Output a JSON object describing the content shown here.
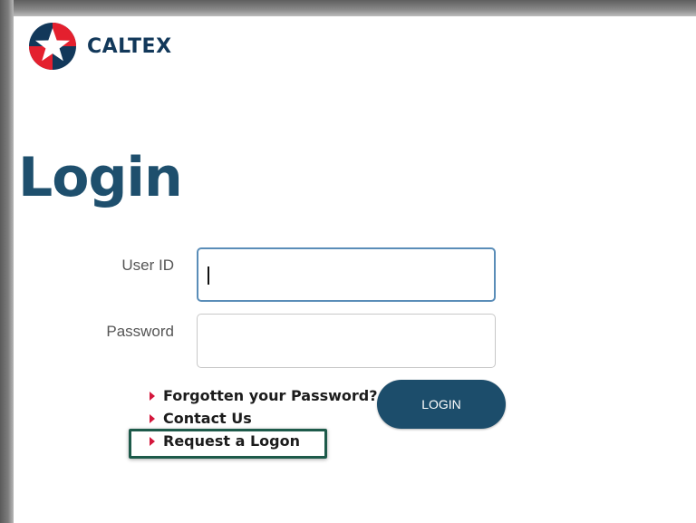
{
  "brand": {
    "name": "CALTEX",
    "colors": {
      "primary": "#1e4f6d",
      "accent_red": "#d4163c",
      "logo_red": "#e4202e",
      "logo_blue": "#12385a"
    }
  },
  "page": {
    "title": "Login"
  },
  "form": {
    "user_id_label": "User ID",
    "user_id_value": "",
    "password_label": "Password",
    "password_value": "",
    "submit_label": "LOGIN"
  },
  "links": [
    {
      "label": "Forgotten your Password?",
      "icon": "arrow-right-icon"
    },
    {
      "label": "Contact Us",
      "icon": "arrow-right-icon"
    },
    {
      "label": "Request a Logon",
      "icon": "arrow-right-icon",
      "highlighted": true
    }
  ],
  "highlight_color": "#1d5a4a"
}
